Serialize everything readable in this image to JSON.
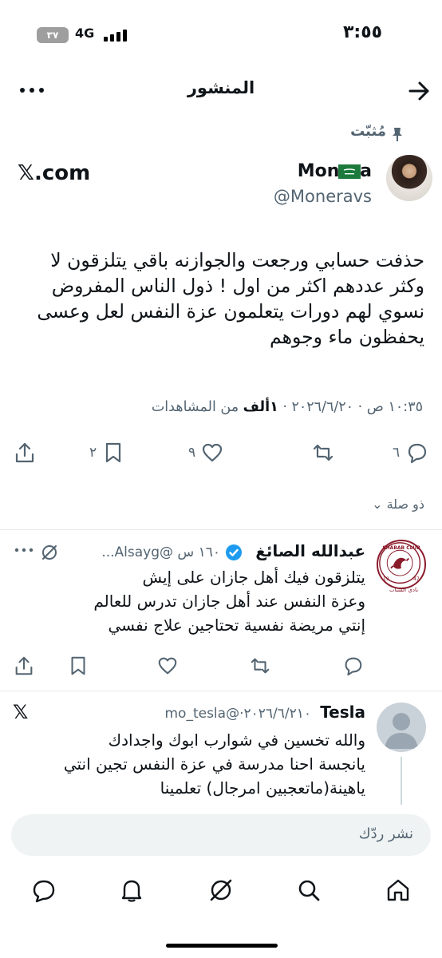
{
  "status": {
    "time": "٣:٥٥",
    "network": "4G",
    "battery": "٣٧"
  },
  "header": {
    "title": "المنشور",
    "back_icon": "arrow-right-icon",
    "more_icon": "more-icon"
  },
  "pinned_label": "مُثبّت",
  "post": {
    "author_name": "Monera",
    "author_handle": "@Moneravs",
    "source": "𝕏.com",
    "text_lines": [
      "حذفت حسابي ورجعت والجوازنه باقي يتلزقون لا",
      "وكثر عددهم اكثر من اول ! ذول الناس المفروض",
      "نسوي لهم دورات يتعلمون عزة النفس لعل وعسى",
      "يحفظون ماء وجوهم"
    ],
    "timestamp": "١٠:٣٥ ص · ٢٠٢٦/٦/٢٠ ·",
    "views_count": "١ألف",
    "views_label": "من المشاهدات",
    "replies": "٦",
    "reposts": "",
    "likes": "٩",
    "bookmarks": "٢"
  },
  "related_label": "ذو صلة",
  "replies": [
    {
      "name": "عبدالله الصائغ",
      "handle_time": "١٦٠ س @Alsayg...",
      "text_lines": [
        "يتلزقون فيك أهل جازان على إيش",
        "وعزة النفس عند أهل جازان تدرس للعالم",
        "إنتي مريضة نفسية تحتاجين علاج نفسي"
      ],
      "logo_text": "SHABAB CLUB",
      "logo_text_ar": "نادي الشباب",
      "logo_year_left": "19",
      "logo_year_right": "47"
    },
    {
      "name": "Tesla",
      "handle_time": "٢٠٢٦/٦/٢١٠·@mo_tesla",
      "text_lines": [
        "والله تخسين في شوارب ابوك واجدادك",
        "يانجسة احنا مدرسة في عزة النفس تجين انتي",
        "ياهينة(ماتعجبين امرجال) تعلمينا"
      ],
      "source": "𝕏"
    }
  ],
  "reply_placeholder": "نشر ردّك",
  "colors": {
    "text": "#0f1419",
    "muted": "#536471",
    "verified": "#1d9bf0",
    "divider": "#e6e9ec"
  }
}
